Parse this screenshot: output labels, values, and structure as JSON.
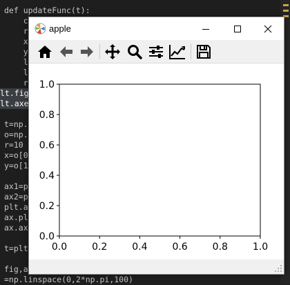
{
  "editor": {
    "lines": [
      "def updateFunc(t):",
      "    c",
      "    r",
      "    x",
      "    y",
      "    l",
      "    l",
      "    r",
      "lt.fig",
      "lt.axe",
      "",
      "t=np.",
      "o=np.",
      "r=10",
      "x=o[0",
      "y=o[1",
      "",
      "ax1=p",
      "ax2=p",
      "plt.a",
      "ax.pl",
      "ax.ax",
      "",
      "t=plt",
      "",
      "fig,a",
      "=np.linspace(0,2*np.pi,100)"
    ]
  },
  "window": {
    "title": "apple",
    "controls": {
      "minimize": "—",
      "maximize": "☐",
      "close": "✕"
    }
  },
  "toolbar": {
    "buttons": [
      "home-icon",
      "back-icon",
      "forward-icon",
      "pan-icon",
      "zoom-icon",
      "configure-subplots-icon",
      "edit-axis-icon",
      "save-icon"
    ]
  },
  "chart_data": {
    "type": "line",
    "series": [],
    "title": "",
    "xlabel": "",
    "ylabel": "",
    "xlim": [
      0.0,
      1.0
    ],
    "ylim": [
      0.0,
      1.0
    ],
    "xticks": [
      "0.0",
      "0.2",
      "0.4",
      "0.6",
      "0.8",
      "1.0"
    ],
    "yticks": [
      "0.0",
      "0.2",
      "0.4",
      "0.6",
      "0.8",
      "1.0"
    ],
    "grid": false
  }
}
